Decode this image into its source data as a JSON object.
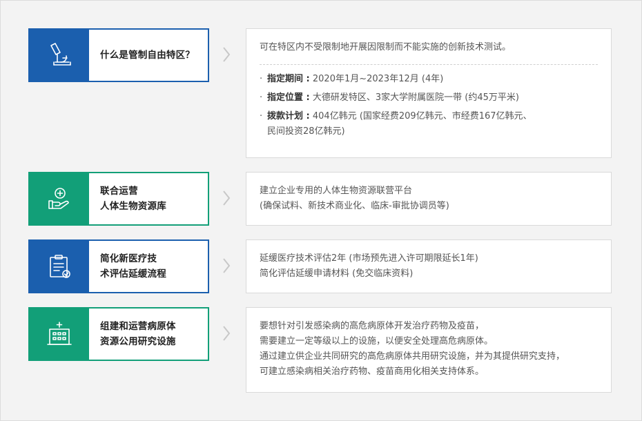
{
  "colors": {
    "blue": "#1b5fae",
    "green": "#129f78"
  },
  "rows": [
    {
      "title": [
        "什么是管制自由特区？"
      ],
      "icon": "microscope-icon",
      "intro": "可在特区内不受限制地开展因限制而不能实施的创新技术测试。",
      "bullets": [
        {
          "label": "指定期间 :",
          "text": "2020年1月~2023年12月 (4年)"
        },
        {
          "label": "指定位置 :",
          "text": "大德研发特区、3家大学附属医院一带 (约45万平米)"
        },
        {
          "label": "拨款计划 :",
          "text": "404亿韩元 (国家经费209亿韩元、市经费167亿韩元、",
          "text2": "民间投资28亿韩元)"
        }
      ]
    },
    {
      "title": [
        "联合运营",
        "人体生物资源库"
      ],
      "icon": "hand-medical-icon",
      "lines": [
        "建立企业专用的人体生物资源联营平台",
        "(确保试料、新技术商业化、临床-审批协调员等)"
      ]
    },
    {
      "title": [
        "简化新医疗技",
        "术评估延缓流程"
      ],
      "icon": "clipboard-check-icon",
      "lines": [
        "延缓医疗技术评估2年 (市场预先进入许可期限延长1年)",
        "简化评估延缓申请材料 (免交临床资料)"
      ]
    },
    {
      "title": [
        "组建和运营病原体",
        "资源公用研究设施"
      ],
      "icon": "hospital-building-icon",
      "lines": [
        "要想针对引发感染病的高危病原体开发治疗药物及疫苗，",
        "需要建立一定等级以上的设施，以便安全处理高危病原体。",
        "通过建立供企业共同研究的高危病原体共用研究设施，并为其提供研究支持，",
        "可建立感染病相关治疗药物、疫苗商用化相关支持体系。"
      ]
    }
  ]
}
